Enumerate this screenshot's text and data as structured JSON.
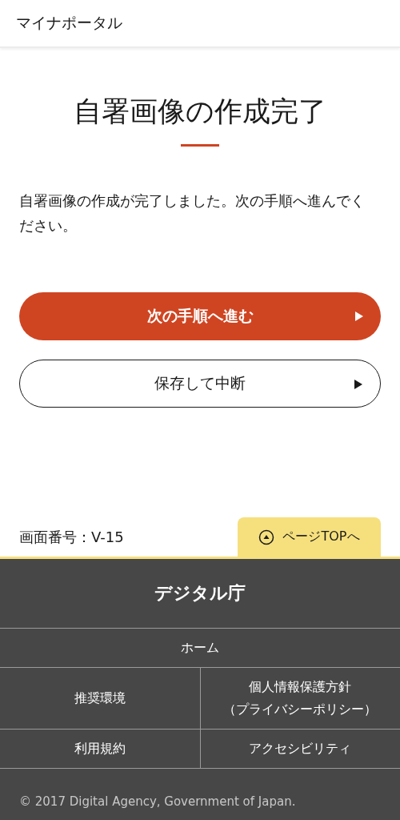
{
  "header": {
    "title": "マイナポータル"
  },
  "page": {
    "heading": "自署画像の作成完了",
    "message": "自署画像の作成が完了しました。次の手順へ進んでください。"
  },
  "buttons": [
    {
      "kind": "primary",
      "label": "次の手順へ進む"
    },
    {
      "kind": "secondary",
      "label": "保存して中断"
    }
  ],
  "screen_id": "画面番号：V-15",
  "page_top": {
    "label": "ページTOPへ"
  },
  "footer": {
    "title": "デジタル庁",
    "link_rows": [
      [
        {
          "label": "ホーム"
        }
      ],
      [
        {
          "label": "推奨環境"
        },
        {
          "label": "個人情報保護方針（プライバシーポリシー）"
        }
      ],
      [
        {
          "label": "利用規約"
        },
        {
          "label": "アクセシビリティ"
        }
      ]
    ],
    "copyright": "© 2017 Digital Agency, Government of Japan."
  }
}
